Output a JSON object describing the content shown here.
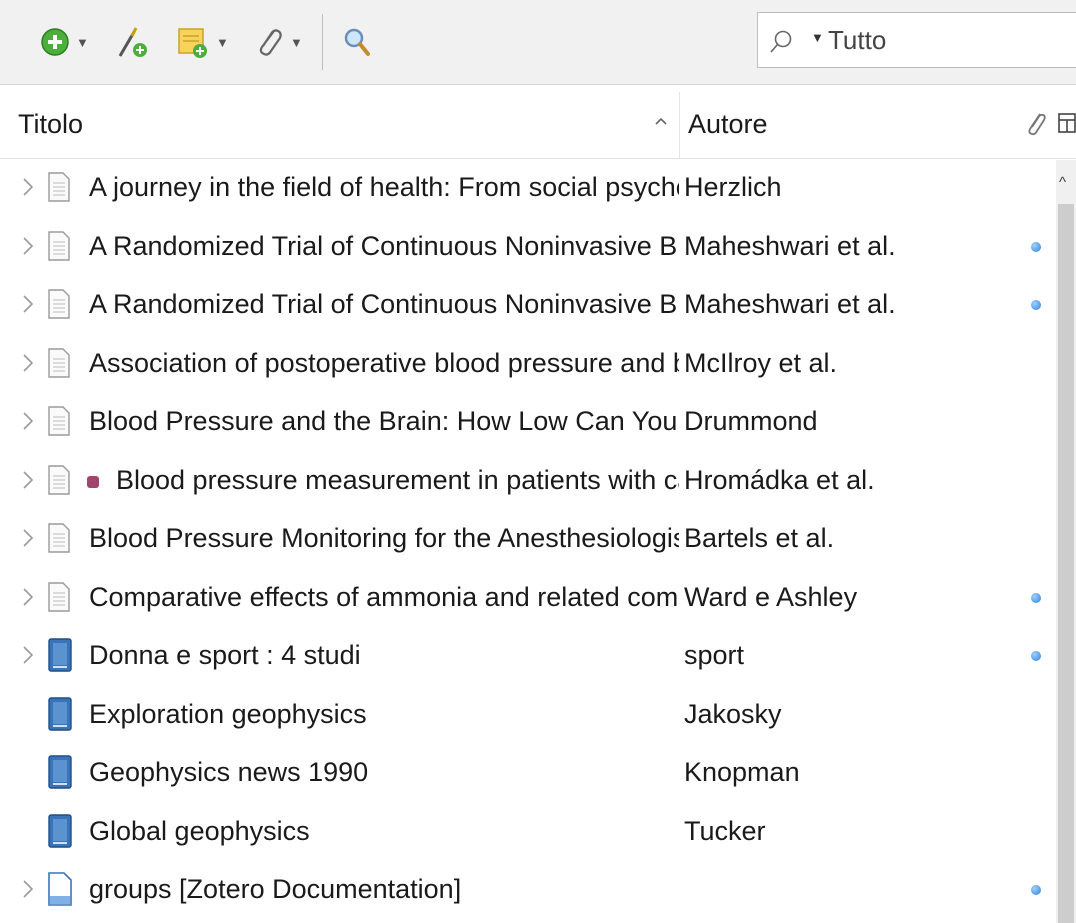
{
  "toolbar": {
    "new_item_icon": "green-plus-circle-icon",
    "new_note_icon": "wand-add-by-identifier-icon",
    "new_note_collection_icon": "note-add-icon",
    "attachment_icon": "paperclip-icon",
    "advanced_search_icon": "magnifier-icon",
    "search": {
      "mode": "Tutto",
      "placeholder": ""
    }
  },
  "columns": {
    "title": "Titolo",
    "author": "Autore",
    "sort_indicator": "^"
  },
  "items": [
    {
      "title": "A journey in the field of health: From social psychology...",
      "author": "Herzlich",
      "type": "document",
      "expandable": true,
      "attachment": false,
      "tag": false
    },
    {
      "title": "A Randomized Trial of Continuous Noninvasive Blood ...",
      "author": "Maheshwari et al.",
      "type": "document",
      "expandable": true,
      "attachment": true,
      "tag": false
    },
    {
      "title": "A Randomized Trial of Continuous Noninvasive Blood ...",
      "author": "Maheshwari et al.",
      "type": "document",
      "expandable": true,
      "attachment": true,
      "tag": false
    },
    {
      "title": "Association of postoperative blood pressure and bleedi...",
      "author": "McIlroy et al.",
      "type": "document",
      "expandable": true,
      "attachment": false,
      "tag": false
    },
    {
      "title": "Blood Pressure and the Brain: How Low Can You Go?",
      "author": "Drummond",
      "type": "document",
      "expandable": true,
      "attachment": false,
      "tag": false
    },
    {
      "title": "Blood pressure measurement in patients with cardio...",
      "author": "Hromádka et al.",
      "type": "document",
      "expandable": true,
      "attachment": false,
      "tag": true
    },
    {
      "title": "Blood Pressure Monitoring for the Anesthesiologist: A ...",
      "author": "Bartels et al.",
      "type": "document",
      "expandable": true,
      "attachment": false,
      "tag": false
    },
    {
      "title": "Comparative effects of ammonia and related compoun...",
      "author": "Ward e Ashley",
      "type": "document",
      "expandable": true,
      "attachment": true,
      "tag": false
    },
    {
      "title": "Donna e sport : 4 studi",
      "author": "sport",
      "type": "book",
      "expandable": true,
      "attachment": true,
      "tag": false
    },
    {
      "title": "Exploration geophysics",
      "author": "Jakosky",
      "type": "book",
      "expandable": false,
      "attachment": false,
      "tag": false
    },
    {
      "title": "Geophysics news 1990",
      "author": "Knopman",
      "type": "book",
      "expandable": false,
      "attachment": false,
      "tag": false
    },
    {
      "title": "Global geophysics",
      "author": "Tucker",
      "type": "book",
      "expandable": false,
      "attachment": false,
      "tag": false
    },
    {
      "title": "groups [Zotero Documentation]",
      "author": "",
      "type": "webpage",
      "expandable": true,
      "attachment": true,
      "tag": false
    }
  ],
  "colors": {
    "tag": "#a0456e",
    "attachment_dot": "#2b82d9",
    "book": "#3a74b8"
  }
}
